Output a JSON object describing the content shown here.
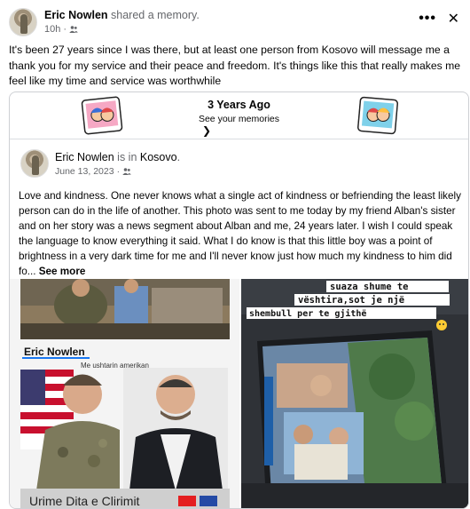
{
  "post": {
    "author": "Eric Nowlen",
    "action": "shared a memory.",
    "time": "10h",
    "more_label": "•••",
    "close_label": "✕",
    "text": "It's been 27 years since I was there, but at least one person from Kosovo will message me a thank you for my service and their peace and freedom. It's things like this that really makes me feel like my time and service was worthwhile"
  },
  "memory": {
    "title": "3 Years Ago",
    "subtitle": "See your memories",
    "chevron": "❯"
  },
  "inner_post": {
    "author": "Eric Nowlen",
    "is_in": "is in",
    "place": "Kosovo",
    "date": "June 13, 2023",
    "text": "Love and kindness. One never knows what a single act of kindness or befriending the least likely person can do in the life of another. This photo was sent to me today by my friend Alban's sister and on her story was a news segment about Alban and me, 24 years later. I wish I could speak the language to know everything it said. What I do know is that this little boy was a point of brightness in a very dark time for me and I'll never know just how much my kindness to him did fo...",
    "see_more": "See more"
  },
  "photo_left": {
    "name_label": "Eric Nowlen",
    "caption": "Me ushtarin amerikan",
    "bottom_text": "Urime Dita e Clirimit"
  },
  "photo_right": {
    "line1": "suaza shume te",
    "line2": "vështira,sot je një",
    "line3": "shembull per te gjithë"
  },
  "colors": {
    "secondary_text": "#65676b",
    "border": "#ced0d4",
    "primary_text": "#050505"
  }
}
